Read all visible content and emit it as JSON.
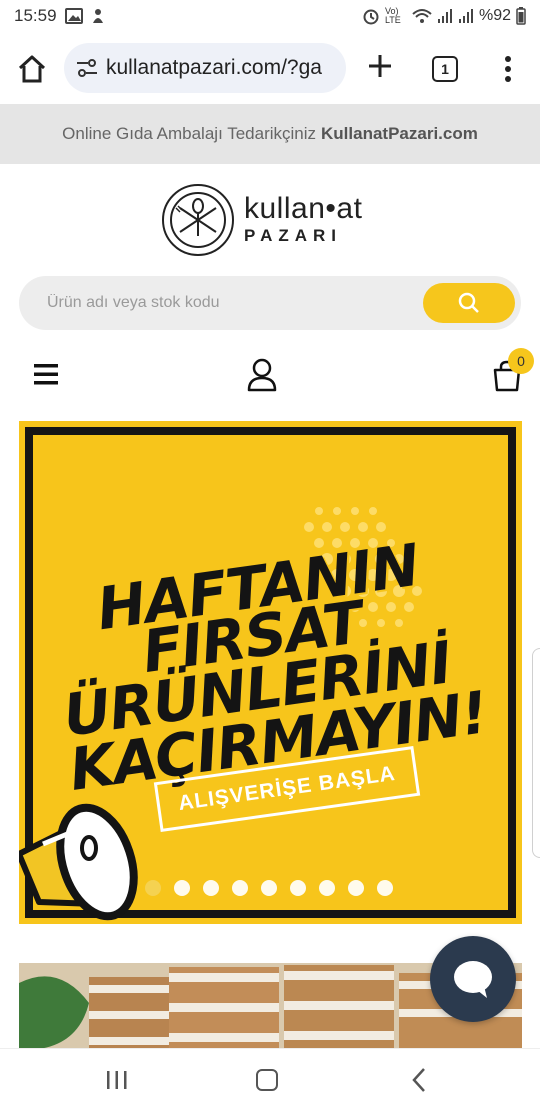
{
  "status_bar": {
    "time": "15:59",
    "battery": "%92",
    "network": "Vo) LTE"
  },
  "browser": {
    "url": "kullanatpazari.com/?ga",
    "tab_count": "1"
  },
  "announcement": {
    "text": "Online Gıda Ambalajı Tedarikçiniz",
    "brand": "KullanatPazari.com"
  },
  "logo": {
    "word": "kullan•at",
    "sub": "PAZARI"
  },
  "search": {
    "placeholder": "Ürün adı veya stok kodu"
  },
  "cart": {
    "count": "0"
  },
  "banner": {
    "lines": [
      "HAFTANIN",
      "FIRSAT",
      "ÜRÜNLERİNİ",
      "KAÇIRMAYIN!"
    ],
    "cta": "ALIŞVERİŞE BAŞLA",
    "slide_count": 9,
    "active_slide": 1
  },
  "colors": {
    "accent": "#f6c61c",
    "banner_bg": "#f7c51b",
    "chat": "#2b3a4e",
    "announce_bg": "#e5e5e5"
  },
  "icons": [
    "home-icon",
    "site-settings-icon",
    "plus-icon",
    "tabs-icon",
    "more-vert-icon",
    "search-icon",
    "hamburger-icon",
    "user-icon",
    "cart-icon",
    "chat-icon",
    "megaphone-icon"
  ]
}
